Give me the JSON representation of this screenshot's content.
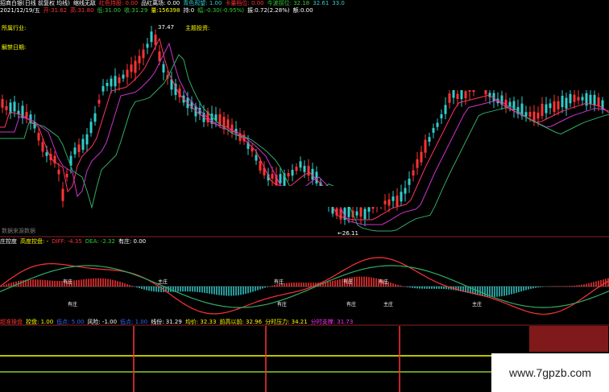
{
  "colors": {
    "bg": "#000000",
    "up": "#ff3333",
    "down": "#33cccc",
    "ma1": "#ff3366",
    "ma2": "#cc33cc",
    "ma3": "#33aa66",
    "yellow": "#ffff00",
    "white": "#ffffff",
    "magenta": "#ff33ff"
  },
  "header": {
    "row1": [
      {
        "text": "招商白银(日线 前复权 均线)",
        "color": "#ffffff"
      },
      {
        "text": "缩线无敌",
        "color": "#ffffff"
      },
      {
        "text": "红色持股: 0.00",
        "color": "#ff3333"
      },
      {
        "text": "品红离场: 0.00",
        "color": "#ffffff"
      },
      {
        "text": "青色观望: 1.00",
        "color": "#33cccc"
      },
      {
        "text": "卡量档位: 0.00",
        "color": "#ff3333"
      },
      {
        "text": "今波拐位: 32.18",
        "color": "#33cc33"
      },
      {
        "text": "32.61",
        "color": "#33cccc"
      },
      {
        "text": "33.02",
        "color": "#33cccc"
      }
    ],
    "row2": [
      {
        "text": "2021/12/19/五",
        "color": "#ffffff"
      },
      {
        "text": "开:31.62",
        "color": "#ff3333"
      },
      {
        "text": "高:31.80",
        "color": "#ff3333"
      },
      {
        "text": "低:31.00",
        "color": "#33cc33"
      },
      {
        "text": "收:31.29",
        "color": "#33cc33"
      },
      {
        "text": "量:156398",
        "color": "#ffff00"
      },
      {
        "text": "持:0",
        "color": "#ffffff"
      },
      {
        "text": "幅:-0.30(-0.95%)",
        "color": "#33cc33"
      },
      {
        "text": "振:0.72(2.28%)",
        "color": "#ffffff"
      },
      {
        "text": "额:0.00",
        "color": "#ffffff"
      }
    ]
  },
  "main_panel": {
    "labels": {
      "industry": "所属行业:",
      "theme": "主题投资:",
      "date": "解禁日期:",
      "high": "37.47",
      "low": "←26.11",
      "footer": "数据来源数据"
    }
  },
  "macd_panel": {
    "header": [
      {
        "text": "庄控度",
        "color": "#ffffff"
      },
      {
        "text": "高度控盘: -",
        "color": "#ffff00"
      },
      {
        "text": "DIFF: -4.35",
        "color": "#ff3333"
      },
      {
        "text": "DEA: -2.32",
        "color": "#33cc33"
      },
      {
        "text": "有庄: 0.00",
        "color": "#ffffff"
      }
    ],
    "tags": [
      "有庄",
      "有庄",
      "有庄",
      "有庄",
      "有庄",
      "有庄",
      "有庄",
      "主庄",
      "主庄",
      "主庄"
    ]
  },
  "bottom_panel": {
    "header": [
      {
        "text": "超准操盘",
        "color": "#ff3333"
      },
      {
        "text": "控盘: 1.00",
        "color": "#ffff00"
      },
      {
        "text": "低点: 5.00",
        "color": "#3366ff"
      },
      {
        "text": "风险: -1.00",
        "color": "#ffffff"
      },
      {
        "text": "低点: 1.00",
        "color": "#3366ff"
      },
      {
        "text": "线份: 31.29",
        "color": "#ffffff"
      },
      {
        "text": "均价: 32.33",
        "color": "#ffff00"
      },
      {
        "text": "前高以前: 32.96",
        "color": "#ffff00"
      },
      {
        "text": "分时压力: 34.21",
        "color": "#ffff00"
      },
      {
        "text": "分时支撑: 31.73",
        "color": "#ff33ff"
      }
    ]
  },
  "watermark": "www.7gpzb.com"
}
